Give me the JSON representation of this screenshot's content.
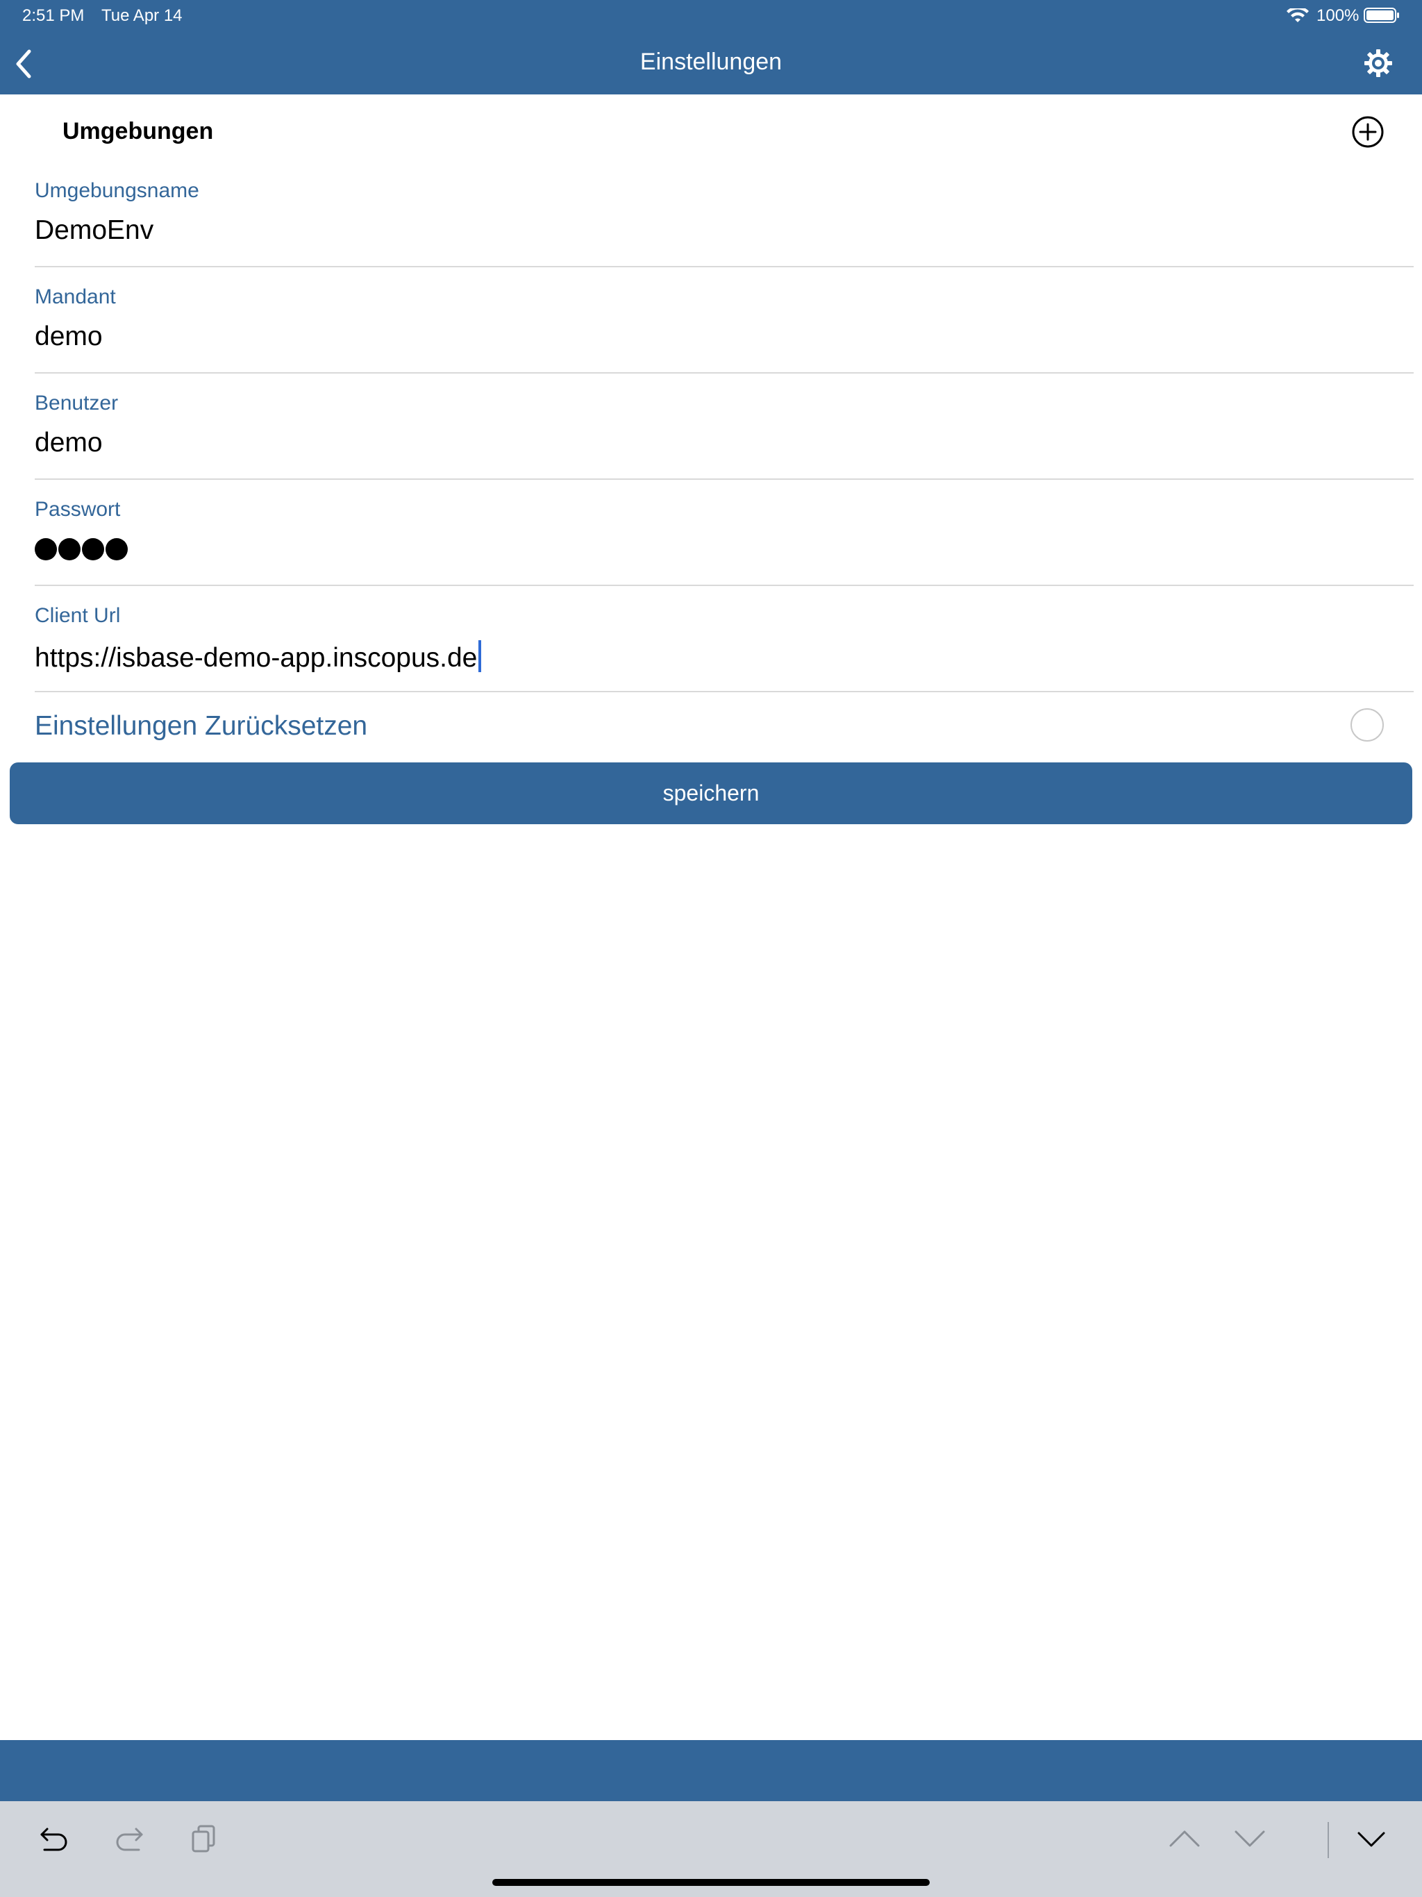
{
  "status_bar": {
    "time": "2:51 PM",
    "date": "Tue Apr 14",
    "battery": "100%"
  },
  "nav": {
    "title": "Einstellungen",
    "back_icon": "chevron-left-icon",
    "settings_icon": "gear-icon"
  },
  "section": {
    "title": "Umgebungen",
    "add_icon": "plus-circle-icon"
  },
  "form": {
    "env_name": {
      "label": "Umgebungsname",
      "value": "DemoEnv"
    },
    "mandant": {
      "label": "Mandant",
      "value": "demo"
    },
    "user": {
      "label": "Benutzer",
      "value": "demo"
    },
    "password": {
      "label": "Passwort",
      "masked_length": 4
    },
    "client_url": {
      "label": "Client Url",
      "value": "https://isbase-demo-app.inscopus.de"
    },
    "reset_label": "Einstellungen Zurücksetzen",
    "reset_checked": false
  },
  "save_button": {
    "label": "speichern"
  },
  "keyboard_toolbar": {
    "undo_icon": "undo-icon",
    "redo_icon": "redo-icon",
    "paste_icon": "paste-icon",
    "prev_icon": "chevron-up-icon",
    "next_icon": "chevron-down-icon",
    "dismiss_icon": "keyboard-dismiss-icon"
  },
  "colors": {
    "brand": "#336699",
    "label": "#336699",
    "toolbar": "#d1d5db",
    "caret": "#2f6bd6"
  }
}
